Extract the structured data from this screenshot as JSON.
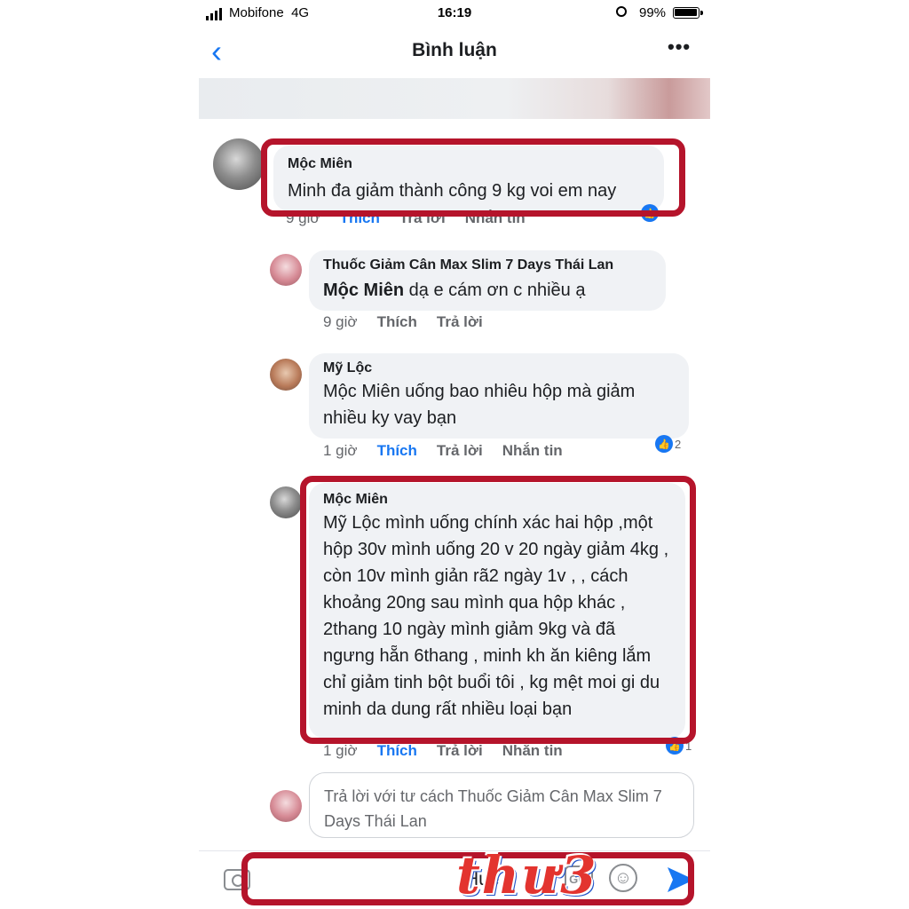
{
  "status_bar": {
    "carrier": "Mobifone",
    "network": "4G",
    "time": "16:19",
    "battery": "99%",
    "battery_level": 0.99
  },
  "header": {
    "title": "Bình luận",
    "more": "•••",
    "back": "‹"
  },
  "comments": [
    {
      "author": "Mộc Miên",
      "text": "Minh đa giảm thành công 9 kg voi em nay",
      "time": "9 giờ",
      "like": "Thích",
      "reply": "Trả lời",
      "message": "Nhắn tin"
    },
    {
      "author": "Thuốc Giảm Cân Max Slim 7 Days Thái Lan",
      "mention": "Mộc Miên",
      "text": " dạ e cám ơn c nhiều ạ",
      "time": "9 giờ",
      "like": "Thích",
      "reply": "Trả lời"
    },
    {
      "author": "Mỹ Lộc",
      "text": "Mộc Miên uống bao nhiêu hộp mà giảm nhiều ky vay bạn",
      "time": "1 giờ",
      "like": "Thích",
      "reply": "Trả lời",
      "message": "Nhắn tin",
      "reactions": "2"
    },
    {
      "author": "Mộc Miên",
      "text": "Mỹ Lộc  mình uống chính xác hai hộp ,một hộp 30v  mình uống 20 v 20 ngày giảm 4kg  , còn 10v mình giản rã2 ngày 1v , , cách khoảng 20ng sau mình qua hộp khác , 2thang 10 ngày mình giảm 9kg và đã ngưng hẵn 6thang , minh kh ăn kiêng lắm chỉ giảm tinh bột buổi tôi , kg mệt moi gi du minh da dung rất nhiều loại bạn",
      "time": "1 giờ",
      "like": "Thích",
      "reply": "Trả lời",
      "message": "Nhắn tin",
      "reactions": "1"
    }
  ],
  "reply_box": {
    "placeholder": "Trả lời với tư cách Thuốc Giảm Cân Max Slim 7 Days Thái Lan"
  },
  "composer": {
    "text": "Huê",
    "gif": "GIF",
    "emoji": "☺"
  },
  "watermark": "thư3"
}
